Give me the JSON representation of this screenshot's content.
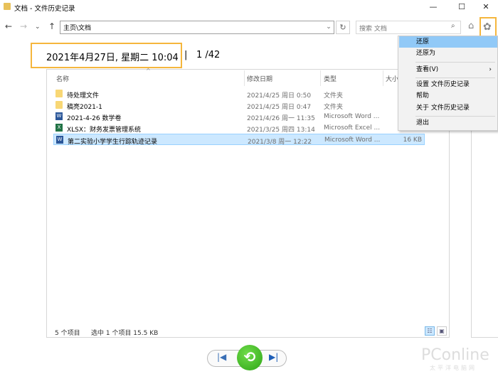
{
  "window": {
    "title": "文档 - 文件历史记录",
    "minimize": "—",
    "maximize": "☐",
    "close": "✕"
  },
  "toolbar": {
    "back": "←",
    "forward": "→",
    "recent": "⌄",
    "up": "↑",
    "address": "主页\\文档",
    "address_dropdown": "⌄",
    "refresh": "↻",
    "search_placeholder": "搜索 文档",
    "search_icon": "⌕",
    "home_icon": "⌂",
    "gear_icon": "✿"
  },
  "snapshot": {
    "date": "2021年4月27日, 星期二 10:04",
    "separator": "|",
    "page": "1 /42"
  },
  "columns": {
    "name": "名称",
    "date": "修改日期",
    "type": "类型",
    "size": "大小"
  },
  "files": [
    {
      "name": "待处理文件",
      "date": "2021/4/25 周日 0:50",
      "type": "文件夹",
      "size": "",
      "icon": "folder"
    },
    {
      "name": "稿亮2021-1",
      "date": "2021/4/25 周日 0:47",
      "type": "文件夹",
      "size": "",
      "icon": "folder"
    },
    {
      "name": "2021-4-26 数学卷",
      "date": "2021/4/26 周一 11:35",
      "type": "Microsoft Word ...",
      "size": "",
      "icon": "word"
    },
    {
      "name": "XLSX：财务发票管理系统",
      "date": "2021/3/25 周四 13:14",
      "type": "Microsoft Excel ...",
      "size": "",
      "icon": "excel"
    },
    {
      "name": "第二实验小学学生行踪轨迹记录",
      "date": "2021/3/8 周一 12:22",
      "type": "Microsoft Word ...",
      "size": "16 KB",
      "icon": "word",
      "selected": true
    }
  ],
  "status": {
    "count": "5 个项目",
    "selection": "选中 1 个项目  15.5 KB"
  },
  "playback": {
    "prev": "|◀",
    "restore": "⟲",
    "next": "▶|"
  },
  "watermark": {
    "brand": "PConline",
    "sub": "太平洋电脑网"
  },
  "menu": {
    "items": [
      "还原",
      "还原为",
      "查看(V)",
      "设置 文件历史记录",
      "帮助",
      "关于 文件历史记录",
      "退出"
    ],
    "submenu_arrow": "›"
  },
  "colors": {
    "highlight": "#f5b63d",
    "selection": "#cce8ff",
    "menu_hover": "#91c9f7",
    "restore_green": "#2ea516"
  }
}
